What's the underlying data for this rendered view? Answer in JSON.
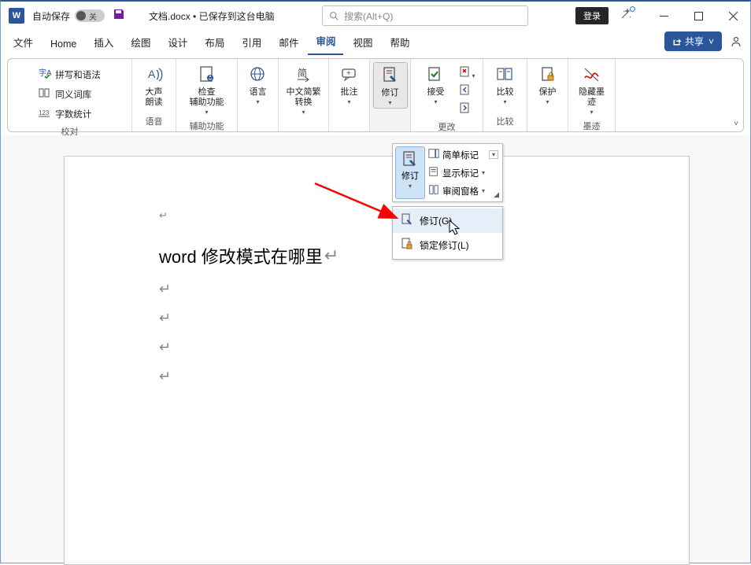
{
  "titlebar": {
    "autosave_label": "自动保存",
    "autosave_state": "关",
    "document_title": "文档.docx • 已保存到这台电脑",
    "search_placeholder": "搜索(Alt+Q)",
    "login_label": "登录"
  },
  "tabs": {
    "items": [
      "文件",
      "Home",
      "插入",
      "绘图",
      "设计",
      "布局",
      "引用",
      "邮件",
      "审阅",
      "视图",
      "帮助"
    ],
    "active_index": 8,
    "share_label": "共享"
  },
  "ribbon": {
    "groups": {
      "proofing": {
        "spell_grammar": "拼写和语法",
        "thesaurus": "同义词库",
        "word_count": "字数统计",
        "label": "校对"
      },
      "speech": {
        "read_aloud": "大声\n朗读",
        "label": "语音"
      },
      "accessibility": {
        "check": "检查\n辅助功能",
        "label": "辅助功能"
      },
      "language": {
        "language": "语言"
      },
      "chinese": {
        "convert": "中文简繁\n转换"
      },
      "comments": {
        "comment": "批注"
      },
      "tracking": {
        "track_changes": "修订",
        "accept": "接受",
        "compare": "比较",
        "protect": "保护",
        "ink": "隐藏墨\n迹",
        "group_changes": "更改",
        "group_compare": "比较",
        "group_ink": "墨迹"
      }
    }
  },
  "dropdown_panel": {
    "track_changes": "修订",
    "simple_markup": "简单标记",
    "show_markup": "显示标记",
    "reviewing_pane": "审阅窗格"
  },
  "submenu": {
    "track_item": "修订(G)",
    "lock_item": "锁定修订(L)"
  },
  "document_body": {
    "heading": "word 修改模式在哪里"
  }
}
